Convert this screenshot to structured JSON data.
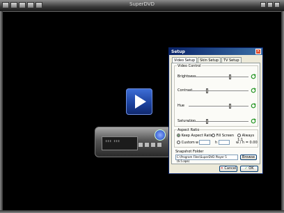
{
  "app": {
    "title": "SuperDVD"
  },
  "dialog": {
    "title": "Setup",
    "close_label": "×",
    "tabs": [
      {
        "label": "Video Setup"
      },
      {
        "label": "Skin Setup"
      },
      {
        "label": "TV Setup"
      }
    ],
    "video_control": {
      "label": "Video Control",
      "rows": [
        {
          "label": "Brightness",
          "value": 0.7
        },
        {
          "label": "Contrast",
          "value": 0.3
        },
        {
          "label": "Hue",
          "value": 0.7
        },
        {
          "label": "Saturation",
          "value": 0.3
        }
      ]
    },
    "aspect_ratio": {
      "label": "Aspect Ratio",
      "options": {
        "keep": "Keep Aspect Ratio",
        "full": "Fill Screen",
        "always": "Always 1:1",
        "custom": "Custom"
      },
      "selected": "keep",
      "w_label": "w",
      "h_label": "h",
      "w_value": "",
      "h_value": "",
      "ratio_text": "w / h = 0.00"
    },
    "snapshot": {
      "label": "Snapshot Folder",
      "path": "C:\\Program Files\\SuperDVD Player 5 (6.5.apa)",
      "browse_label": "Browse"
    },
    "buttons": {
      "cancel": "Cancel",
      "ok": "OK"
    }
  },
  "colors": {
    "dialog_bg": "#ece9d8",
    "titlebar": "#0a246a",
    "accent_play": "#2a58c8",
    "reset_icon": "#2e9a2e"
  },
  "icons": [
    "play-icon",
    "refresh-icon",
    "close-icon",
    "check-icon",
    "cross-icon"
  ]
}
